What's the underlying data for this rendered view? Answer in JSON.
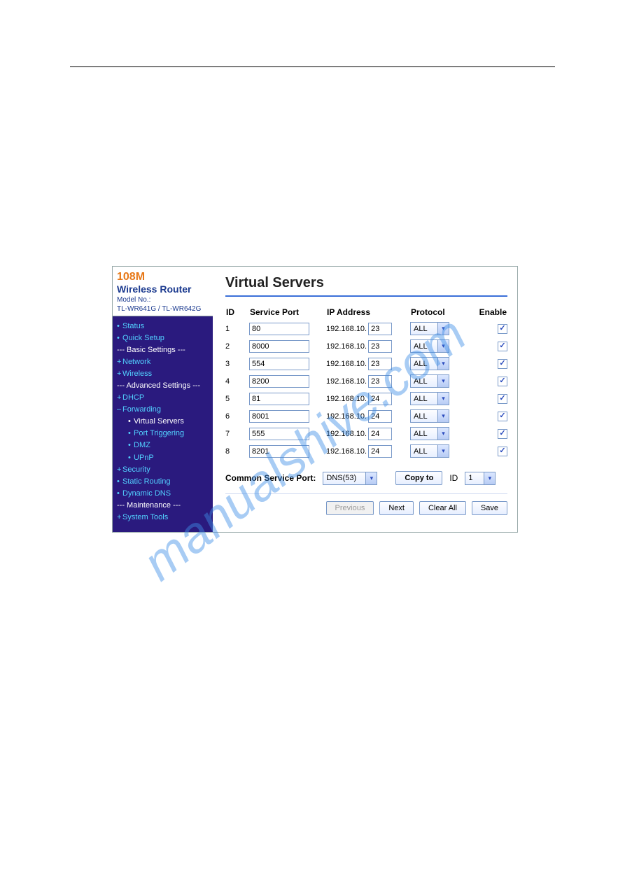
{
  "brand": {
    "tag": "108M",
    "title": "Wireless  Router",
    "model_label": "Model No.:",
    "model": "TL-WR641G / TL-WR642G"
  },
  "nav": {
    "status": "Status",
    "quick_setup": "Quick Setup",
    "basic_hdr": "--- Basic Settings ---",
    "network": "Network",
    "wireless": "Wireless",
    "adv_hdr": "--- Advanced Settings ---",
    "dhcp": "DHCP",
    "forwarding": "Forwarding",
    "virtual_servers": "Virtual Servers",
    "port_triggering": "Port Triggering",
    "dmz": "DMZ",
    "upnp": "UPnP",
    "security": "Security",
    "static_routing": "Static Routing",
    "dynamic_dns": "Dynamic DNS",
    "maint_hdr": "--- Maintenance ---",
    "system_tools": "System Tools"
  },
  "page": {
    "title": "Virtual Servers",
    "th_id": "ID",
    "th_port": "Service Port",
    "th_ip": "IP Address",
    "th_proto": "Protocol",
    "th_enable": "Enable",
    "ip_prefix": "192.168.10.",
    "rows": [
      {
        "id": "1",
        "port": "80",
        "ip": "23",
        "proto": "ALL",
        "enabled": true
      },
      {
        "id": "2",
        "port": "8000",
        "ip": "23",
        "proto": "ALL",
        "enabled": true
      },
      {
        "id": "3",
        "port": "554",
        "ip": "23",
        "proto": "ALL",
        "enabled": true
      },
      {
        "id": "4",
        "port": "8200",
        "ip": "23",
        "proto": "ALL",
        "enabled": true
      },
      {
        "id": "5",
        "port": "81",
        "ip": "24",
        "proto": "ALL",
        "enabled": true
      },
      {
        "id": "6",
        "port": "8001",
        "ip": "24",
        "proto": "ALL",
        "enabled": true
      },
      {
        "id": "7",
        "port": "555",
        "ip": "24",
        "proto": "ALL",
        "enabled": true
      },
      {
        "id": "8",
        "port": "8201",
        "ip": "24",
        "proto": "ALL",
        "enabled": true
      }
    ],
    "common_label": "Common Service Port:",
    "common_value": "DNS(53)",
    "copy_btn": "Copy to",
    "id_label": "ID",
    "id_value": "1",
    "prev_btn": "Previous",
    "next_btn": "Next",
    "clear_btn": "Clear All",
    "save_btn": "Save"
  },
  "watermark": "manualshive.com"
}
